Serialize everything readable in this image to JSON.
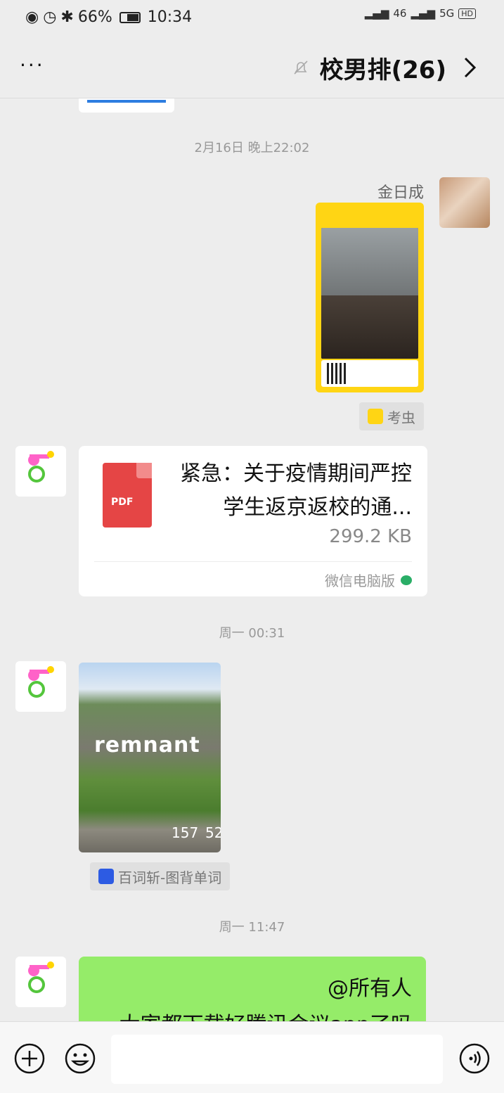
{
  "status_bar": {
    "time": "10:34",
    "battery": "66%",
    "network": "46",
    "network2": "5G",
    "hd": "HD"
  },
  "header": {
    "title": "校男排(26)",
    "more_label": "···"
  },
  "messages": {
    "ts1": "2月16日 晚上22:02",
    "sender1_name": "金日成",
    "app_tag1": "考虫",
    "file_title": "紧急：关于疫情期间严控学生返京返校的通...",
    "file_size": "299.2 KB",
    "file_source": "微信电脑版",
    "ts2": "周一 00:31",
    "photo_word": "remnant",
    "photo_num1": "52",
    "photo_num2": "157",
    "app_tag2": "百词斩-图背单词",
    "ts3": "周一 11:47",
    "text_line1": "@所有人",
    "text_line2": "大家都下载好腾讯会议app了吗"
  },
  "colors": {
    "background": "#ededed",
    "bubble_green": "#95ec69",
    "pdf_red": "#e54545",
    "poster_yellow": "#ffd514",
    "wechat_green": "#2aae67"
  },
  "icons": {
    "more": "more-dots-icon",
    "mute": "bell-mute-icon",
    "back": "chevron-right-icon",
    "plus": "plus-circle-icon",
    "emoji": "smile-icon",
    "voice": "voice-icon"
  }
}
